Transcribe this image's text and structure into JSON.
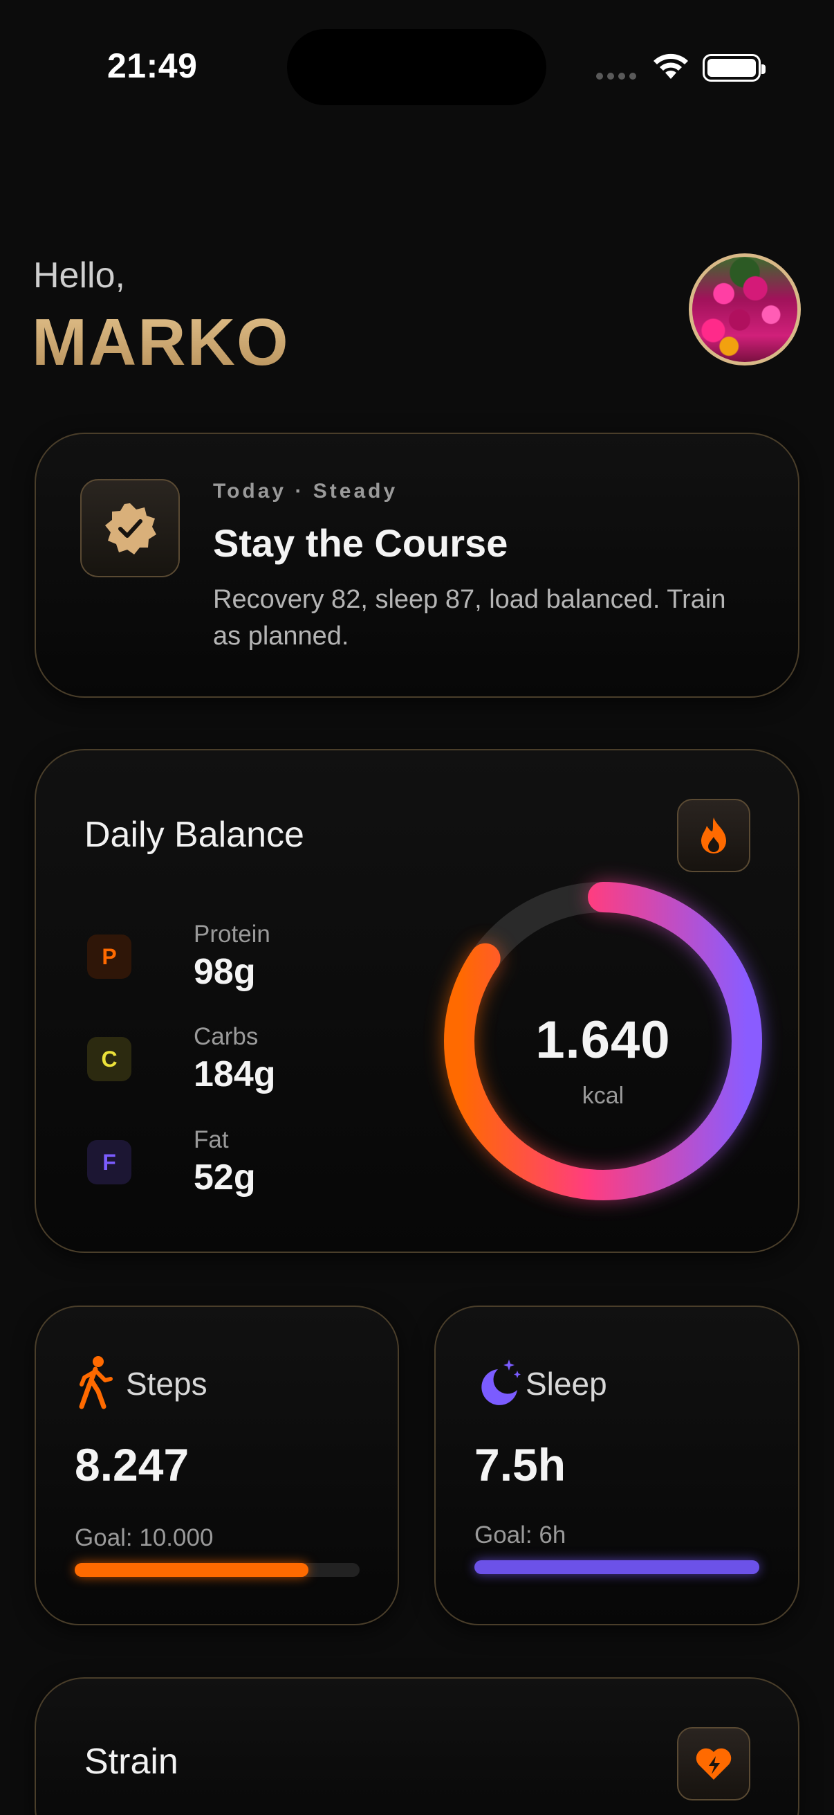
{
  "status_bar": {
    "time": "21:49"
  },
  "greeting": {
    "hello": "Hello,",
    "name": "MARKO"
  },
  "status_card": {
    "kicker": "Today · Steady",
    "title": "Stay the Course",
    "description": "Recovery 82, sleep 87, load balanced. Train as planned."
  },
  "daily_balance": {
    "title": "Daily Balance",
    "macros": [
      {
        "letter": "P",
        "label": "Protein",
        "value": "98g",
        "color": "#ff6a00"
      },
      {
        "letter": "C",
        "label": "Carbs",
        "value": "184g",
        "color": "#e8e23a"
      },
      {
        "letter": "F",
        "label": "Fat",
        "value": "52g",
        "color": "#7b5cff"
      }
    ],
    "calories": {
      "value": "1.640",
      "unit": "kcal"
    }
  },
  "steps": {
    "label": "Steps",
    "value": "8.247",
    "goal": "Goal: 10.000",
    "progress": 0.82,
    "color": "#ff6a00"
  },
  "sleep": {
    "label": "Sleep",
    "value": "7.5h",
    "goal": "Goal: 6h",
    "progress": 1.0,
    "color": "#6c52e8"
  },
  "strain": {
    "title": "Strain"
  },
  "colors": {
    "accent_gold": "#c9a46c",
    "orange": "#ff6a00",
    "pink": "#ff3d7f",
    "purple": "#7b5cff"
  }
}
